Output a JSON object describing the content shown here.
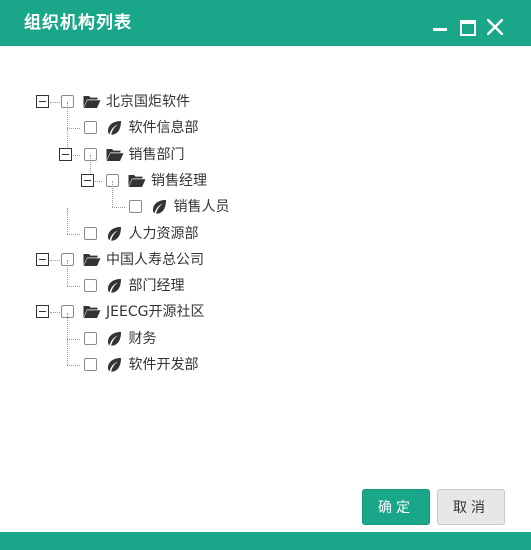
{
  "dialog": {
    "title": "组织机构列表",
    "accent": "#1aa688"
  },
  "icons": {
    "folder": "folder-open-icon",
    "leaf": "leaf-icon",
    "minimize": "minimize-icon",
    "maximize": "maximize-icon",
    "close": "close-icon"
  },
  "tree": [
    {
      "label": "北京国炬软件",
      "type": "folder",
      "level": 0,
      "expanded": true,
      "checked": false
    },
    {
      "label": "软件信息部",
      "type": "leaf",
      "level": 1,
      "checked": false
    },
    {
      "label": "销售部门",
      "type": "folder",
      "level": 1,
      "expanded": true,
      "checked": false
    },
    {
      "label": "销售经理",
      "type": "folder",
      "level": 2,
      "expanded": true,
      "checked": false
    },
    {
      "label": "销售人员",
      "type": "leaf",
      "level": 3,
      "checked": false
    },
    {
      "label": "人力资源部",
      "type": "leaf",
      "level": 1,
      "checked": false
    },
    {
      "label": "中国人寿总公司",
      "type": "folder",
      "level": 0,
      "expanded": true,
      "checked": false
    },
    {
      "label": "部门经理",
      "type": "leaf",
      "level": 1,
      "checked": false
    },
    {
      "label": "JEECG开源社区",
      "type": "folder",
      "level": 0,
      "expanded": true,
      "checked": false
    },
    {
      "label": "财务",
      "type": "leaf",
      "level": 1,
      "checked": false
    },
    {
      "label": "软件开发部",
      "type": "leaf",
      "level": 1,
      "checked": false
    }
  ],
  "buttons": {
    "ok": "确定",
    "cancel": "取消"
  }
}
